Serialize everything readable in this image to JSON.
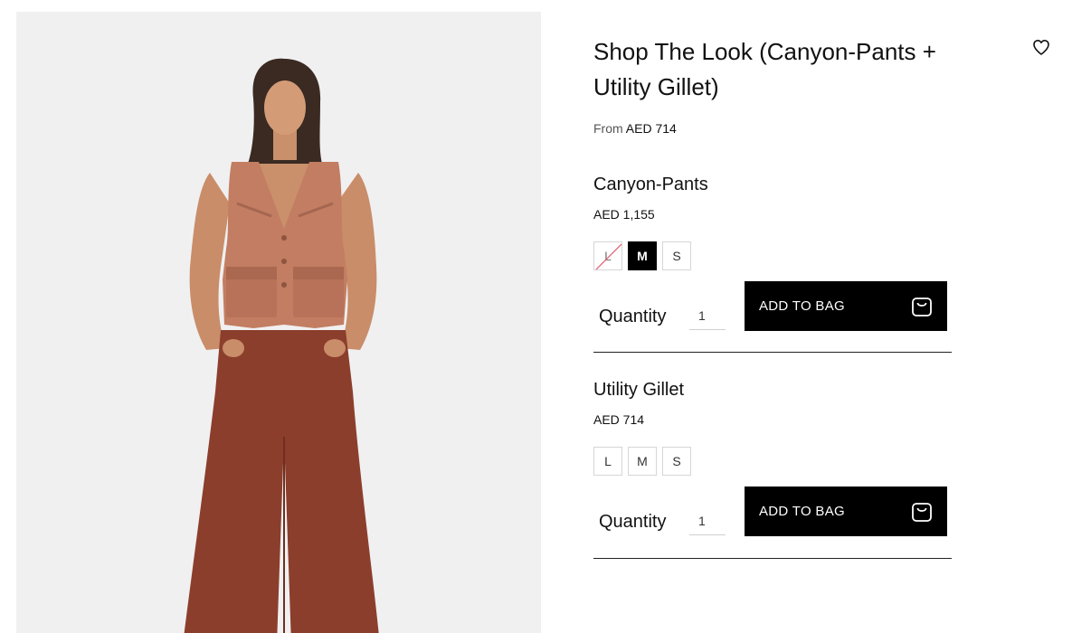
{
  "product": {
    "title": "Shop The Look (Canyon-Pants + Utility Gillet)",
    "from_label": "From",
    "from_price": "AED 714",
    "image_alt": "Model wearing a terracotta utility gillet and wide-leg rust canyon pants"
  },
  "icons": {
    "wishlist": "heart-icon",
    "bag": "shopping-bag-icon"
  },
  "items": [
    {
      "name": "Canyon-Pants",
      "price": "AED 1,155",
      "sizes": [
        {
          "label": "L",
          "state": "unavailable"
        },
        {
          "label": "M",
          "state": "selected"
        },
        {
          "label": "S",
          "state": "available"
        }
      ],
      "quantity_label": "Quantity",
      "quantity_value": "1",
      "add_to_bag_label": "ADD TO BAG"
    },
    {
      "name": "Utility Gillet",
      "price": "AED 714",
      "sizes": [
        {
          "label": "L",
          "state": "available"
        },
        {
          "label": "M",
          "state": "available"
        },
        {
          "label": "S",
          "state": "available"
        }
      ],
      "quantity_label": "Quantity",
      "quantity_value": "1",
      "add_to_bag_label": "ADD TO BAG"
    }
  ],
  "colors": {
    "button_bg": "#000000",
    "image_bg": "#f0f0f1",
    "strike": "#e0566a"
  }
}
